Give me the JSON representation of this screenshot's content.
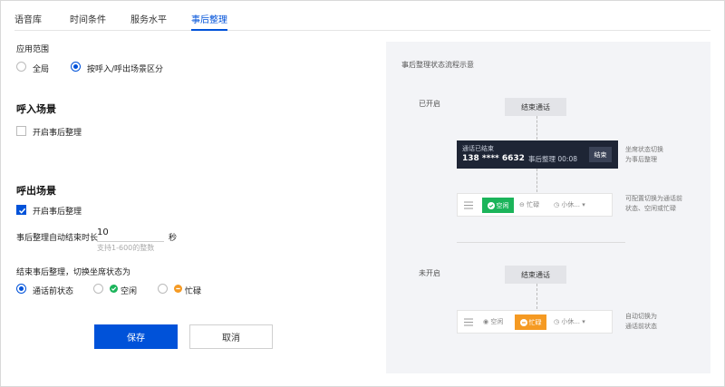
{
  "tabs": [
    {
      "label": "语音库"
    },
    {
      "label": "时间条件"
    },
    {
      "label": "服务水平"
    },
    {
      "label": "事后整理"
    }
  ],
  "scope": {
    "label": "应用范围",
    "options": [
      {
        "label": "全局",
        "selected": false
      },
      {
        "label": "按呼入/呼出场景区分",
        "selected": true
      }
    ]
  },
  "inbound": {
    "title": "呼入场景",
    "enable_label": "开启事后整理",
    "enabled": false
  },
  "outbound": {
    "title": "呼出场景",
    "enable_label": "开启事后整理",
    "enabled": true,
    "duration_label": "事后整理自动结束时长",
    "duration_value": "10",
    "duration_unit": "秒",
    "duration_hint": "支持1-600的整数",
    "switch_label": "结束事后整理，切换坐席状态为",
    "switch_options": [
      {
        "label": "通话前状态",
        "selected": true
      },
      {
        "label": "空闲",
        "selected": false,
        "icon": "check-circle-icon",
        "color": "#1bb45a"
      },
      {
        "label": "忙碌",
        "selected": false,
        "icon": "minus-circle-icon",
        "color": "#f59a23"
      }
    ]
  },
  "actions": {
    "save": "保存",
    "cancel": "取消"
  },
  "diagram": {
    "title": "事后整理状态流程示意",
    "enabled": {
      "label": "已开启",
      "end_call": "结束通话",
      "card_line1": "通话已结束",
      "card_number": "138 **** 6632",
      "card_status": "事后整理 00:08",
      "card_button": "结束",
      "note1": [
        "坐席状态切换",
        "为事后整理"
      ],
      "bar": {
        "idle": "空闲",
        "busy": "忙碌",
        "rest": "小休..."
      },
      "note2": [
        "可配置切换为通话前",
        "状态、空闲或忙碌"
      ]
    },
    "disabled": {
      "label": "未开启",
      "end_call": "结束通话",
      "bar": {
        "idle": "空闲",
        "busy": "忙碌",
        "rest": "小休..."
      },
      "note": [
        "自动切换为",
        "通话前状态"
      ]
    },
    "colors": {
      "idle": "#1bb45a",
      "busy": "#f59a23",
      "accent": "#0052d9"
    }
  }
}
